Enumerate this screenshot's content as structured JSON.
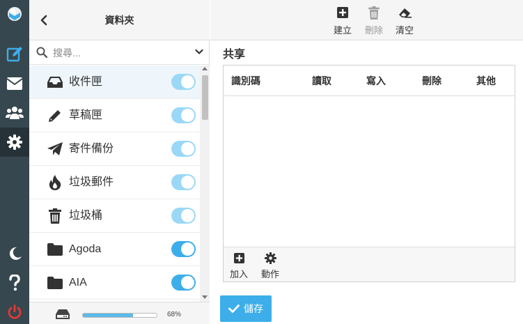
{
  "app": {
    "rail": [
      {
        "icon": "logo-icon"
      },
      {
        "icon": "compose-icon"
      },
      {
        "icon": "mail-icon"
      },
      {
        "icon": "contacts-icon"
      },
      {
        "icon": "settings-gear-icon",
        "active": true
      },
      {
        "icon": "moon-icon"
      },
      {
        "icon": "help-icon"
      },
      {
        "icon": "power-icon"
      }
    ]
  },
  "folders_panel": {
    "title": "資料夾",
    "search_placeholder": "搜尋...",
    "items": [
      {
        "name": "收件匣",
        "icon": "inbox-icon",
        "toggle": "faded"
      },
      {
        "name": "草稿匣",
        "icon": "pencil-icon",
        "toggle": "faded"
      },
      {
        "name": "寄件備份",
        "icon": "paper-plane-icon",
        "toggle": "faded"
      },
      {
        "name": "垃圾郵件",
        "icon": "fire-icon",
        "toggle": "faded"
      },
      {
        "name": "垃圾桶",
        "icon": "trash-icon",
        "toggle": "faded"
      },
      {
        "name": "Agoda",
        "icon": "folder-icon",
        "toggle": "on"
      },
      {
        "name": "AIA",
        "icon": "folder-icon",
        "toggle": "on"
      }
    ],
    "quota": {
      "percent_label": "68%",
      "fraction": 0.68
    }
  },
  "toolbar": {
    "create_label": "建立",
    "delete_label": "刪除",
    "clear_label": "清空"
  },
  "share": {
    "title": "共享",
    "columns": [
      "識別碼",
      "讀取",
      "寫入",
      "刪除",
      "其他"
    ],
    "add_label": "加入",
    "actions_label": "動作"
  },
  "save_label": "儲存",
  "colors": {
    "rail_bg": "#37474f",
    "accent": "#3daee9",
    "power": "#e53935"
  }
}
